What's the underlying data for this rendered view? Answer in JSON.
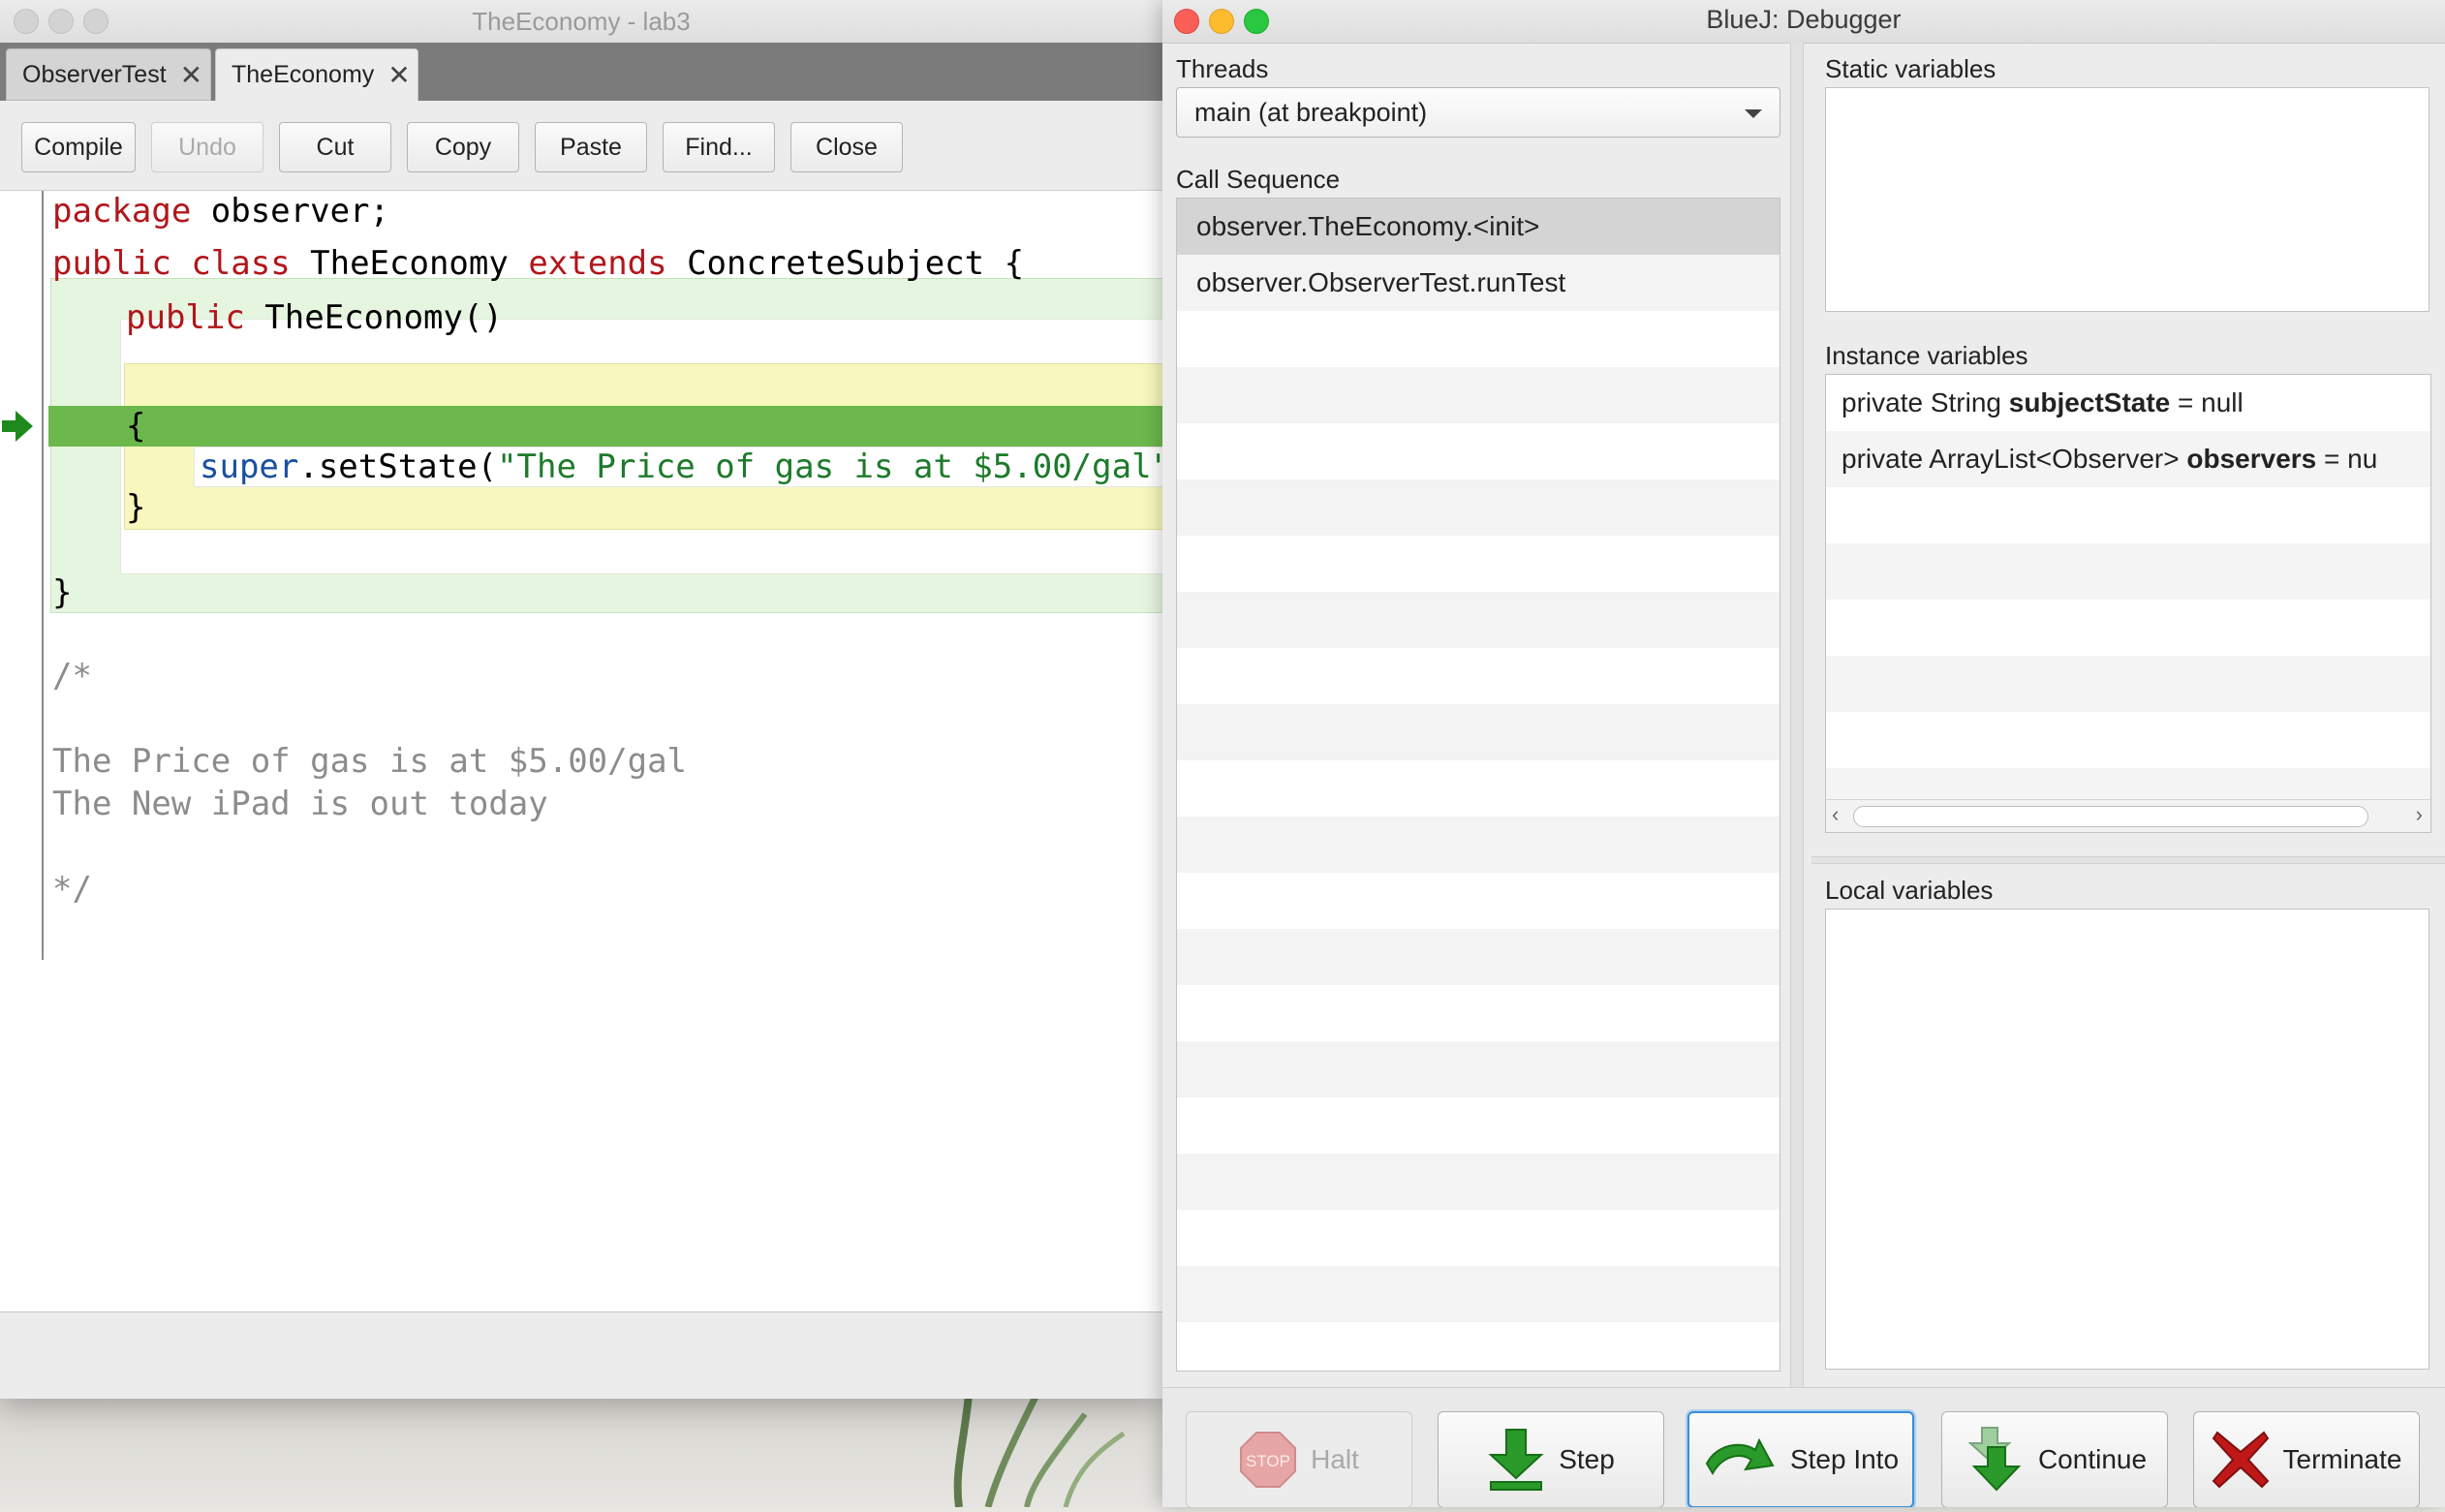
{
  "editor": {
    "window_title": "TheEconomy - lab3",
    "tabs": [
      {
        "label": "ObserverTest",
        "close": "✕"
      },
      {
        "label": "TheEconomy",
        "close": "✕"
      }
    ],
    "toolbar": {
      "compile": "Compile",
      "undo": "Undo",
      "cut": "Cut",
      "copy": "Copy",
      "paste": "Paste",
      "find": "Find...",
      "close": "Close"
    },
    "code": {
      "l1_kw": "package",
      "l1_rest": " observer;",
      "l2_kw1": "public",
      "l2_kw2": "class",
      "l2_name": " TheEconomy ",
      "l2_kw3": "extends",
      "l2_rest": " ConcreteSubject {",
      "l3_kw": "public",
      "l3_rest": " TheEconomy()",
      "l4": "{",
      "l5_kw": "super",
      "l5_mid": ".setState(",
      "l5_str": "\"The Price of gas is at $5.00/gal\"",
      "l5_end": ");",
      "l6": "}",
      "l7": "}",
      "c1": "/*",
      "c2": "The Price of gas is at $5.00/gal",
      "c3": "The New iPad is out today",
      "c4": "*/"
    }
  },
  "debugger": {
    "window_title": "BlueJ:  Debugger",
    "threads_label": "Threads",
    "threads_selected": "main (at breakpoint)",
    "call_sequence_label": "Call Sequence",
    "call_sequence": [
      "observer.TheEconomy.<init>",
      "observer.ObserverTest.runTest"
    ],
    "static_label": "Static variables",
    "instance_label": "Instance variables",
    "instance_vars": [
      {
        "prefix": "private String ",
        "name": "subjectState",
        "suffix": " = null"
      },
      {
        "prefix": "private ArrayList<Observer> ",
        "name": "observers",
        "suffix": " = nu"
      }
    ],
    "local_label": "Local variables",
    "buttons": {
      "halt": "Halt",
      "stop_sign": "STOP",
      "step": "Step",
      "step_into": "Step Into",
      "continue": "Continue",
      "terminate": "Terminate"
    }
  },
  "colors": {
    "breakpoint_line": "#6cb84c",
    "keyword": "#b1161a",
    "string": "#1d7a2a",
    "comment": "#8c8c8c",
    "focus_ring": "#3b8fd6"
  }
}
